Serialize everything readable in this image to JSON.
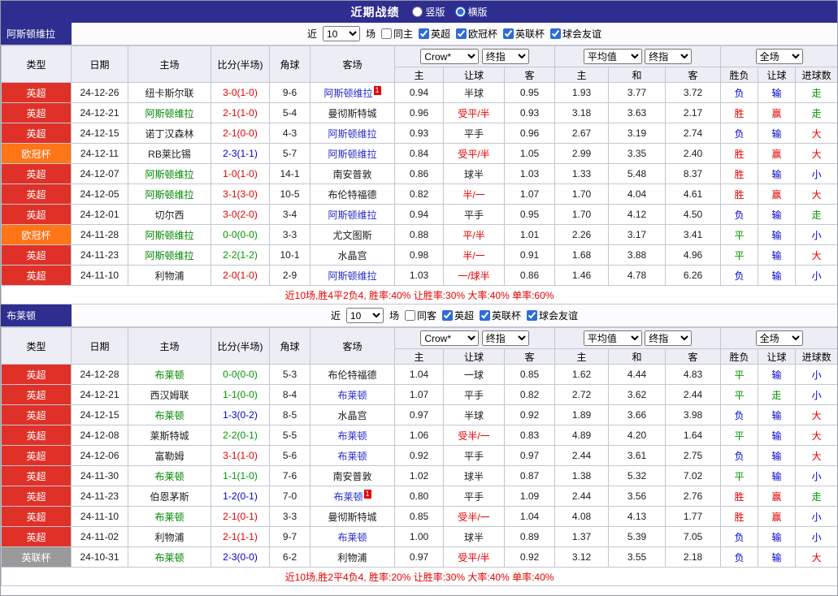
{
  "topbar": {
    "title": "近期战绩",
    "view_options": [
      {
        "label": "竖版",
        "selected": false
      },
      {
        "label": "横版",
        "selected": true
      }
    ]
  },
  "colors": {
    "league": {
      "英超": "#e03128",
      "欧冠杯": "#ff7517",
      "英联杯": "#9a9a9a"
    },
    "win": "#e60000",
    "draw": "#009700",
    "loss": "#0000cc"
  },
  "filters_common": {
    "prefix": "近",
    "count": "10",
    "suffix": "场"
  },
  "table_header": {
    "cols": [
      "类型",
      "日期",
      "主场",
      "比分(半场)",
      "角球",
      "客场"
    ],
    "odds_source_select": "Crow*",
    "odds_time_select": "终指",
    "avg_source_select": "平均值",
    "avg_time_select": "终指",
    "scope_select": "全场",
    "sub_cols": [
      "主",
      "让球",
      "客",
      "主",
      "和",
      "客",
      "胜负",
      "让球",
      "进球数"
    ]
  },
  "sections": [
    {
      "team": "阿斯顿维拉",
      "same_filter": {
        "label": "同主",
        "checked": false
      },
      "league_filters": [
        {
          "label": "英超",
          "checked": true
        },
        {
          "label": "欧冠杯",
          "checked": true
        },
        {
          "label": "英联杯",
          "checked": true
        },
        {
          "label": "球会友谊",
          "checked": true
        }
      ],
      "rows": [
        {
          "league": "英超",
          "date": "24-12-26",
          "home": "纽卡斯尔联",
          "score": "3-0(1-0)",
          "corner": "9-6",
          "away": "阿斯顿维拉",
          "away_card": "1",
          "odds": [
            "0.94",
            "半球",
            "0.95"
          ],
          "avg": [
            "1.93",
            "3.77",
            "3.72"
          ],
          "result": [
            "负",
            "输",
            "走"
          ]
        },
        {
          "league": "英超",
          "date": "24-12-21",
          "home": "阿斯顿维拉",
          "score": "2-1(1-0)",
          "corner": "5-4",
          "away": "曼彻斯特城",
          "odds": [
            "0.96",
            "受平/半",
            "0.93"
          ],
          "avg": [
            "3.18",
            "3.63",
            "2.17"
          ],
          "result": [
            "胜",
            "赢",
            "走"
          ]
        },
        {
          "league": "英超",
          "date": "24-12-15",
          "home": "诺丁汉森林",
          "score": "2-1(0-0)",
          "corner": "4-3",
          "away": "阿斯顿维拉",
          "odds": [
            "0.93",
            "平手",
            "0.96"
          ],
          "avg": [
            "2.67",
            "3.19",
            "2.74"
          ],
          "result": [
            "负",
            "输",
            "大"
          ]
        },
        {
          "league": "欧冠杯",
          "date": "24-12-11",
          "home": "RB莱比锡",
          "score": "2-3(1-1)",
          "corner": "5-7",
          "away": "阿斯顿维拉",
          "odds": [
            "0.84",
            "受平/半",
            "1.05"
          ],
          "avg": [
            "2.99",
            "3.35",
            "2.40"
          ],
          "result": [
            "胜",
            "赢",
            "大"
          ]
        },
        {
          "league": "英超",
          "date": "24-12-07",
          "home": "阿斯顿维拉",
          "score": "1-0(1-0)",
          "corner": "14-1",
          "away": "南安普敦",
          "odds": [
            "0.86",
            "球半",
            "1.03"
          ],
          "avg": [
            "1.33",
            "5.48",
            "8.37"
          ],
          "result": [
            "胜",
            "输",
            "小"
          ]
        },
        {
          "league": "英超",
          "date": "24-12-05",
          "home": "阿斯顿维拉",
          "score": "3-1(3-0)",
          "corner": "10-5",
          "away": "布伦特福德",
          "odds": [
            "0.82",
            "半/一",
            "1.07"
          ],
          "avg": [
            "1.70",
            "4.04",
            "4.61"
          ],
          "result": [
            "胜",
            "赢",
            "大"
          ]
        },
        {
          "league": "英超",
          "date": "24-12-01",
          "home": "切尔西",
          "score": "3-0(2-0)",
          "corner": "3-4",
          "away": "阿斯顿维拉",
          "odds": [
            "0.94",
            "平手",
            "0.95"
          ],
          "avg": [
            "1.70",
            "4.12",
            "4.50"
          ],
          "result": [
            "负",
            "输",
            "走"
          ]
        },
        {
          "league": "欧冠杯",
          "date": "24-11-28",
          "home": "阿斯顿维拉",
          "score": "0-0(0-0)",
          "corner": "3-3",
          "away": "尤文图斯",
          "odds": [
            "0.88",
            "平/半",
            "1.01"
          ],
          "avg": [
            "2.26",
            "3.17",
            "3.41"
          ],
          "result": [
            "平",
            "输",
            "小"
          ]
        },
        {
          "league": "英超",
          "date": "24-11-23",
          "home": "阿斯顿维拉",
          "score": "2-2(1-2)",
          "corner": "10-1",
          "away": "水晶宫",
          "odds": [
            "0.98",
            "半/一",
            "0.91"
          ],
          "avg": [
            "1.68",
            "3.88",
            "4.96"
          ],
          "result": [
            "平",
            "输",
            "大"
          ]
        },
        {
          "league": "英超",
          "date": "24-11-10",
          "home": "利物浦",
          "score": "2-0(1-0)",
          "corner": "2-9",
          "away": "阿斯顿维拉",
          "odds": [
            "1.03",
            "一/球半",
            "0.86"
          ],
          "avg": [
            "1.46",
            "4.78",
            "6.26"
          ],
          "result": [
            "负",
            "输",
            "小"
          ]
        }
      ],
      "summary": "近10场,胜4平2负4, 胜率:40% 让胜率:30% 大率:40% 单率:60%"
    },
    {
      "team": "布莱顿",
      "same_filter": {
        "label": "同客",
        "checked": false
      },
      "league_filters": [
        {
          "label": "英超",
          "checked": true
        },
        {
          "label": "英联杯",
          "checked": true
        },
        {
          "label": "球会友谊",
          "checked": true
        }
      ],
      "rows": [
        {
          "league": "英超",
          "date": "24-12-28",
          "home": "布莱顿",
          "score": "0-0(0-0)",
          "corner": "5-3",
          "away": "布伦特福德",
          "odds": [
            "1.04",
            "一球",
            "0.85"
          ],
          "avg": [
            "1.62",
            "4.44",
            "4.83"
          ],
          "result": [
            "平",
            "输",
            "小"
          ]
        },
        {
          "league": "英超",
          "date": "24-12-21",
          "home": "西汉姆联",
          "score": "1-1(0-0)",
          "corner": "8-4",
          "away": "布莱顿",
          "odds": [
            "1.07",
            "平手",
            "0.82"
          ],
          "avg": [
            "2.72",
            "3.62",
            "2.44"
          ],
          "result": [
            "平",
            "走",
            "小"
          ]
        },
        {
          "league": "英超",
          "date": "24-12-15",
          "home": "布莱顿",
          "score": "1-3(0-2)",
          "corner": "8-5",
          "away": "水晶宫",
          "odds": [
            "0.97",
            "半球",
            "0.92"
          ],
          "avg": [
            "1.89",
            "3.66",
            "3.98"
          ],
          "result": [
            "负",
            "输",
            "大"
          ]
        },
        {
          "league": "英超",
          "date": "24-12-08",
          "home": "莱斯特城",
          "score": "2-2(0-1)",
          "corner": "5-5",
          "away": "布莱顿",
          "odds": [
            "1.06",
            "受半/一",
            "0.83"
          ],
          "avg": [
            "4.89",
            "4.20",
            "1.64"
          ],
          "result": [
            "平",
            "输",
            "大"
          ]
        },
        {
          "league": "英超",
          "date": "24-12-06",
          "home": "富勒姆",
          "score": "3-1(1-0)",
          "corner": "5-6",
          "away": "布莱顿",
          "odds": [
            "0.92",
            "平手",
            "0.97"
          ],
          "avg": [
            "2.44",
            "3.61",
            "2.75"
          ],
          "result": [
            "负",
            "输",
            "大"
          ]
        },
        {
          "league": "英超",
          "date": "24-11-30",
          "home": "布莱顿",
          "score": "1-1(1-0)",
          "corner": "7-6",
          "away": "南安普敦",
          "odds": [
            "1.02",
            "球半",
            "0.87"
          ],
          "avg": [
            "1.38",
            "5.32",
            "7.02"
          ],
          "result": [
            "平",
            "输",
            "小"
          ]
        },
        {
          "league": "英超",
          "date": "24-11-23",
          "home": "伯恩茅斯",
          "score": "1-2(0-1)",
          "corner": "7-0",
          "away": "布莱顿",
          "away_card": "1",
          "odds": [
            "0.80",
            "平手",
            "1.09"
          ],
          "avg": [
            "2.44",
            "3.56",
            "2.76"
          ],
          "result": [
            "胜",
            "赢",
            "走"
          ]
        },
        {
          "league": "英超",
          "date": "24-11-10",
          "home": "布莱顿",
          "score": "2-1(0-1)",
          "corner": "3-3",
          "away": "曼彻斯特城",
          "odds": [
            "0.85",
            "受半/一",
            "1.04"
          ],
          "avg": [
            "4.08",
            "4.13",
            "1.77"
          ],
          "result": [
            "胜",
            "赢",
            "小"
          ]
        },
        {
          "league": "英超",
          "date": "24-11-02",
          "home": "利物浦",
          "score": "2-1(1-1)",
          "corner": "9-7",
          "away": "布莱顿",
          "odds": [
            "1.00",
            "球半",
            "0.89"
          ],
          "avg": [
            "1.37",
            "5.39",
            "7.05"
          ],
          "result": [
            "负",
            "输",
            "小"
          ]
        },
        {
          "league": "英联杯",
          "date": "24-10-31",
          "home": "布莱顿",
          "score": "2-3(0-0)",
          "corner": "6-2",
          "away": "利物浦",
          "odds": [
            "0.97",
            "受平/半",
            "0.92"
          ],
          "avg": [
            "3.12",
            "3.55",
            "2.18"
          ],
          "result": [
            "负",
            "输",
            "大"
          ]
        }
      ],
      "summary": "近10场,胜2平4负4, 胜率:20% 让胜率:30% 大率:40% 单率:40%"
    }
  ]
}
